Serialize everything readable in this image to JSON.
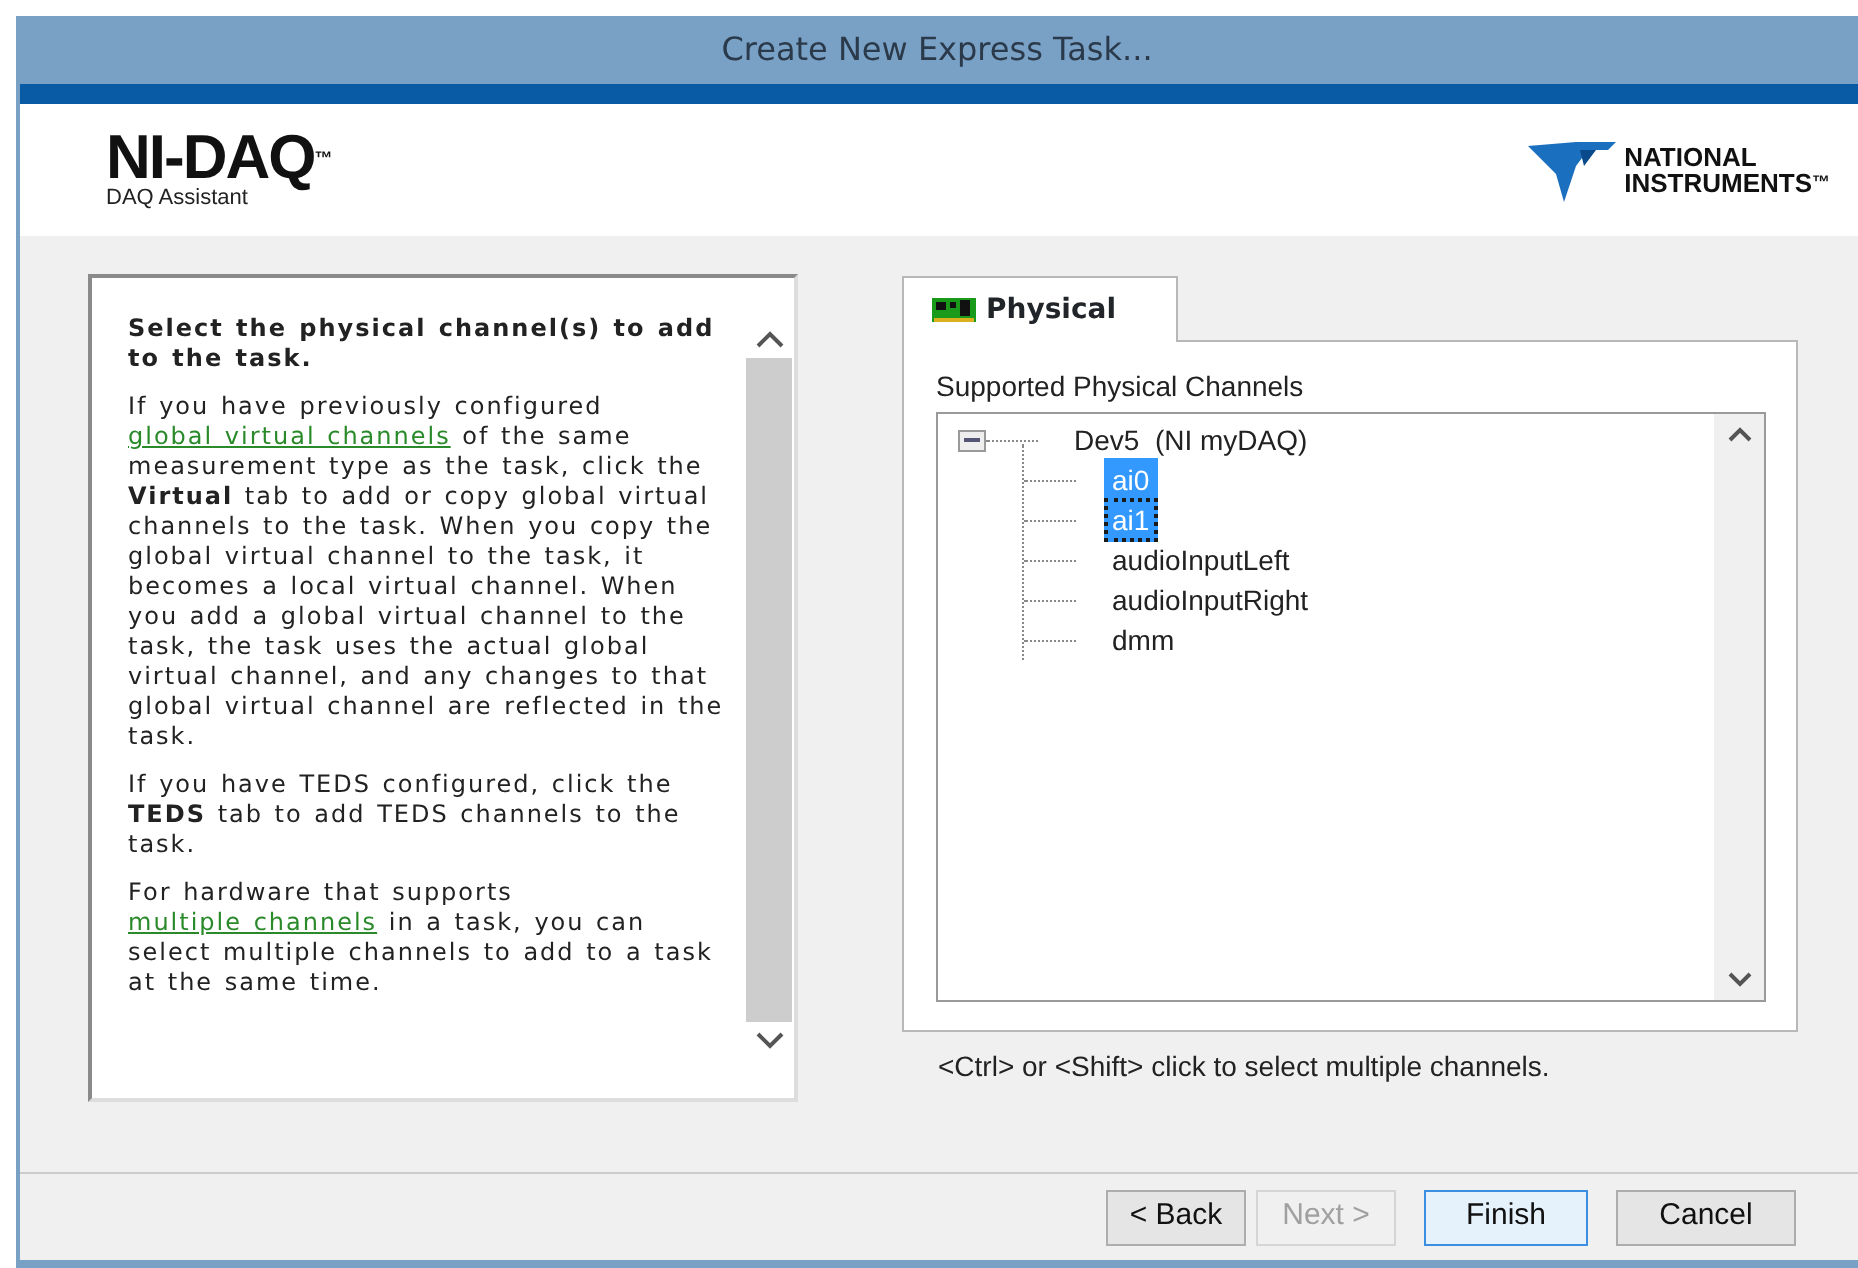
{
  "window": {
    "title": "Create New Express Task..."
  },
  "header": {
    "product": "NI-DAQ",
    "trademark": "™",
    "subtitle": "DAQ Assistant",
    "vendor_lines": [
      "NATIONAL",
      "INSTRUMENTS"
    ],
    "vendor_trademark": "™"
  },
  "help": {
    "heading": "Select the physical channel(s) to add to the task.",
    "paragraphs": [
      [
        {
          "kind": "text",
          "text": "If you have previously configured "
        },
        {
          "kind": "link",
          "text": "global virtual channels"
        },
        {
          "kind": "text",
          "text": " of the same measurement type as the task, click the **Virtual** tab to add or copy global virtual channels to the task. When you copy the global virtual channel to the task, it becomes a local virtual channel. When you add a global virtual channel to the task, the task uses the actual global virtual channel, and any changes to that global virtual channel are reflected in the task."
        }
      ],
      [
        {
          "kind": "text",
          "text": "If you have TEDS configured, click the **TEDS** tab to add TEDS channels to the task."
        }
      ],
      [
        {
          "kind": "text",
          "text": "For hardware that supports "
        },
        {
          "kind": "link",
          "text": "multiple channels"
        },
        {
          "kind": "text",
          "text": " in a task, you can select multiple channels to add to a task at the same time."
        }
      ]
    ]
  },
  "tabs": [
    {
      "label": "Physical",
      "selected": true
    }
  ],
  "channels": {
    "label": "Supported Physical Channels",
    "tree": [
      {
        "label": "Dev5  (NI myDAQ)",
        "expanded": true,
        "children": [
          {
            "label": "ai0",
            "selected": true,
            "focused": false
          },
          {
            "label": "ai1",
            "selected": true,
            "focused": true
          },
          {
            "label": "audioInputLeft",
            "selected": false,
            "focused": false
          },
          {
            "label": "audioInputRight",
            "selected": false,
            "focused": false
          },
          {
            "label": "dmm",
            "selected": false,
            "focused": false
          }
        ]
      }
    ],
    "hint": "<Ctrl> or <Shift> click to select multiple channels."
  },
  "buttons": [
    {
      "label": "< Back",
      "disabled": false,
      "default": false
    },
    {
      "label": "Next >",
      "disabled": true,
      "default": false
    },
    {
      "label": "Finish",
      "disabled": false,
      "default": true
    },
    {
      "label": "Cancel",
      "disabled": false,
      "default": false
    }
  ]
}
